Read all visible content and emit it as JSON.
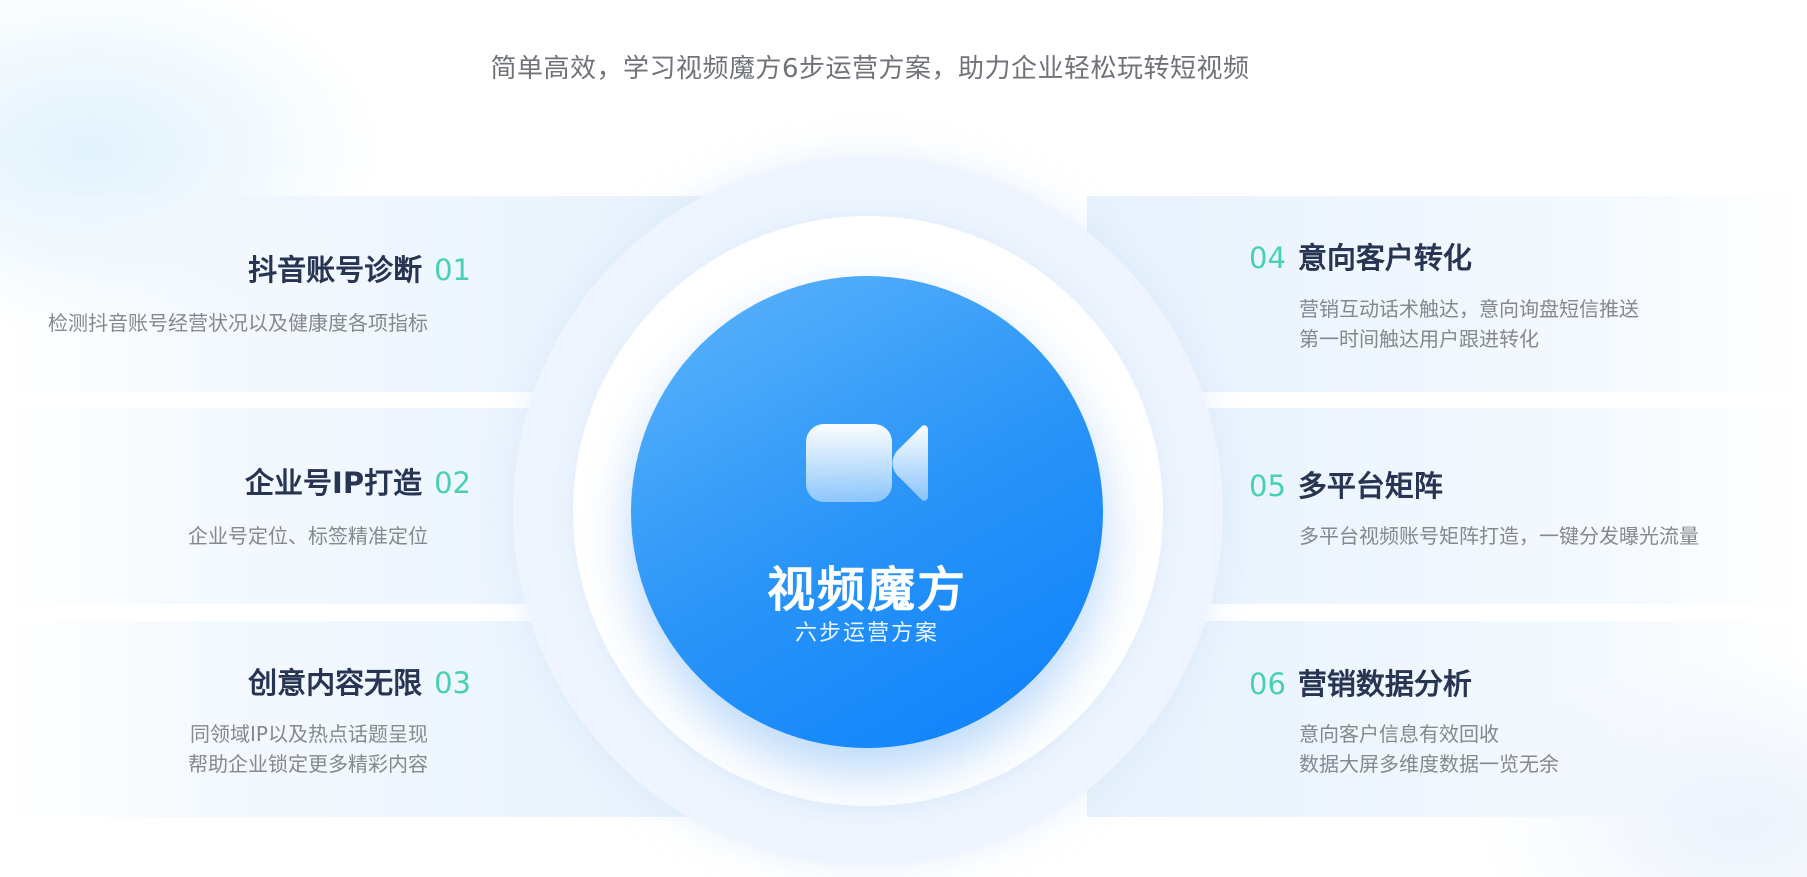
{
  "subtitle": "简单高效，学习视频魔方6步运营方案，助力企业轻松玩转短视频",
  "center": {
    "icon": "video-camera-icon",
    "title": "视频魔方",
    "subtitle": "六步运营方案"
  },
  "colors": {
    "accent_number": "#46d0b8",
    "core_start": "#5fb6fb",
    "core_end": "#0a80fb",
    "title_text": "#273452",
    "desc_text": "#85898f"
  },
  "steps": [
    {
      "num": "01",
      "title": "抖音账号诊断",
      "desc": [
        "检测抖音账号经营状况以及健康度各项指标"
      ]
    },
    {
      "num": "02",
      "title": "企业号IP打造",
      "desc": [
        "企业号定位、标签精准定位"
      ]
    },
    {
      "num": "03",
      "title": "创意内容无限",
      "desc": [
        "同领域IP以及热点话题呈现",
        "帮助企业锁定更多精彩内容"
      ]
    },
    {
      "num": "04",
      "title": "意向客户转化",
      "desc": [
        "营销互动话术触达，意向询盘短信推送",
        "第一时间触达用户跟进转化"
      ]
    },
    {
      "num": "05",
      "title": "多平台矩阵",
      "desc": [
        "多平台视频账号矩阵打造，一键分发曝光流量"
      ]
    },
    {
      "num": "06",
      "title": "营销数据分析",
      "desc": [
        "意向客户信息有效回收",
        "数据大屏多维度数据一览无余"
      ]
    }
  ]
}
